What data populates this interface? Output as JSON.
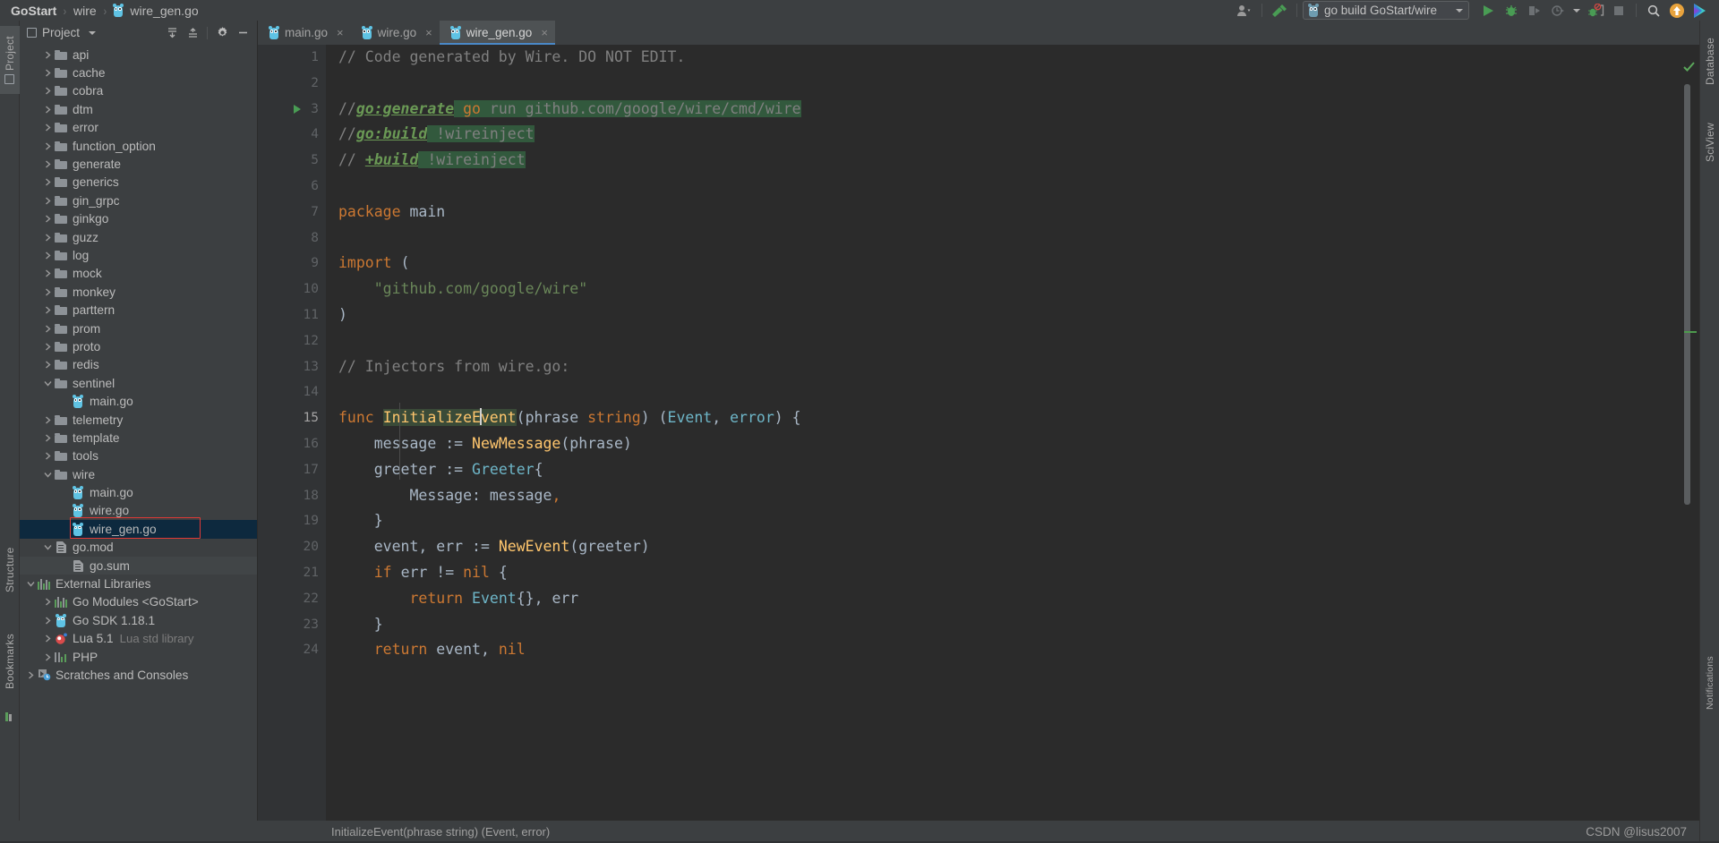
{
  "breadcrumb": {
    "project": "GoStart",
    "folder": "wire",
    "file": "wire_gen.go",
    "separator": "›"
  },
  "toolbar": {
    "user_icon": "user-avatar-icon",
    "build_icon": "hammer-icon",
    "run_config": "go build GoStart/wire",
    "run_icon": "run-play-icon",
    "debug_icon": "debug-bug-icon",
    "run_coverage_icon": "run-with-coverage-icon",
    "profiler_icon": "profiler-icon",
    "attach_icon": "attach-debugger-icon",
    "stop_icon": "stop-icon",
    "search_icon": "search-everywhere-icon",
    "update_icon": "update-project-icon",
    "ide_icon": "ide-logo-icon"
  },
  "left_strip": {
    "items": [
      {
        "label": "Project",
        "selected": true
      },
      {
        "label": "Structure",
        "selected": false
      },
      {
        "label": "Bookmarks",
        "selected": false
      }
    ]
  },
  "right_strip": {
    "items": [
      {
        "label": "Database"
      },
      {
        "label": "SciView"
      },
      {
        "label": "Notifications"
      }
    ]
  },
  "project_panel": {
    "title": "Project",
    "tools": {
      "expand_all": "expand-all-icon",
      "collapse_all": "collapse-all-icon",
      "settings": "gear-icon",
      "hide": "hide-panel-icon",
      "dropdown": "chevron-down-icon"
    },
    "tree": [
      {
        "label": "api",
        "type": "folder",
        "indent": 1,
        "state": "collapsed"
      },
      {
        "label": "cache",
        "type": "folder",
        "indent": 1,
        "state": "collapsed"
      },
      {
        "label": "cobra",
        "type": "folder",
        "indent": 1,
        "state": "collapsed"
      },
      {
        "label": "dtm",
        "type": "folder",
        "indent": 1,
        "state": "collapsed"
      },
      {
        "label": "error",
        "type": "folder",
        "indent": 1,
        "state": "collapsed"
      },
      {
        "label": "function_option",
        "type": "folder",
        "indent": 1,
        "state": "collapsed"
      },
      {
        "label": "generate",
        "type": "folder",
        "indent": 1,
        "state": "collapsed"
      },
      {
        "label": "generics",
        "type": "folder",
        "indent": 1,
        "state": "collapsed"
      },
      {
        "label": "gin_grpc",
        "type": "folder",
        "indent": 1,
        "state": "collapsed"
      },
      {
        "label": "ginkgo",
        "type": "folder",
        "indent": 1,
        "state": "collapsed"
      },
      {
        "label": "guzz",
        "type": "folder",
        "indent": 1,
        "state": "collapsed"
      },
      {
        "label": "log",
        "type": "folder",
        "indent": 1,
        "state": "collapsed"
      },
      {
        "label": "mock",
        "type": "folder",
        "indent": 1,
        "state": "collapsed"
      },
      {
        "label": "monkey",
        "type": "folder",
        "indent": 1,
        "state": "collapsed"
      },
      {
        "label": "parttern",
        "type": "folder",
        "indent": 1,
        "state": "collapsed"
      },
      {
        "label": "prom",
        "type": "folder",
        "indent": 1,
        "state": "collapsed"
      },
      {
        "label": "proto",
        "type": "folder",
        "indent": 1,
        "state": "collapsed"
      },
      {
        "label": "redis",
        "type": "folder",
        "indent": 1,
        "state": "collapsed"
      },
      {
        "label": "sentinel",
        "type": "folder",
        "indent": 1,
        "state": "expanded"
      },
      {
        "label": "main.go",
        "type": "go",
        "indent": 2,
        "state": "leaf"
      },
      {
        "label": "telemetry",
        "type": "folder",
        "indent": 1,
        "state": "collapsed"
      },
      {
        "label": "template",
        "type": "folder",
        "indent": 1,
        "state": "collapsed"
      },
      {
        "label": "tools",
        "type": "folder",
        "indent": 1,
        "state": "collapsed"
      },
      {
        "label": "wire",
        "type": "folder",
        "indent": 1,
        "state": "expanded"
      },
      {
        "label": "main.go",
        "type": "go",
        "indent": 2,
        "state": "leaf"
      },
      {
        "label": "wire.go",
        "type": "go",
        "indent": 2,
        "state": "leaf"
      },
      {
        "label": "wire_gen.go",
        "type": "go",
        "indent": 2,
        "state": "leaf",
        "selected": true,
        "highlighted": true
      },
      {
        "label": "go.mod",
        "type": "doc",
        "indent": 1,
        "state": "expanded"
      },
      {
        "label": "go.sum",
        "type": "doc",
        "indent": 2,
        "state": "leaf",
        "shaded": true
      },
      {
        "label": "External Libraries",
        "type": "bars",
        "indent": 0,
        "state": "expanded"
      },
      {
        "label": "Go Modules <GoStart>",
        "type": "bars",
        "indent": 1,
        "state": "collapsed"
      },
      {
        "label": "Go SDK 1.18.1",
        "type": "go",
        "indent": 1,
        "state": "collapsed"
      },
      {
        "label": "Lua 5.1",
        "sub": "Lua std library",
        "type": "lua",
        "indent": 1,
        "state": "collapsed"
      },
      {
        "label": "PHP",
        "type": "php",
        "indent": 1,
        "state": "collapsed"
      },
      {
        "label": "Scratches and Consoles",
        "type": "scratch",
        "indent": 0,
        "state": "collapsed"
      }
    ]
  },
  "editor": {
    "tabs": [
      {
        "label": "main.go",
        "active": false,
        "close": "×"
      },
      {
        "label": "wire.go",
        "active": false,
        "close": "×"
      },
      {
        "label": "wire_gen.go",
        "active": true,
        "close": "×"
      }
    ],
    "lines": [
      {
        "n": "1",
        "html": "<span class='c-cmt'>// Code generated by Wire. DO NOT EDIT.</span>"
      },
      {
        "n": "2",
        "html": ""
      },
      {
        "n": "3",
        "html": "<span class='c-cmt'>//</span><span class='c-dir'>go:generate</span><span class='hl-green'> <span class='c-kw'>go</span> <span class='c-cmt'>run github.com/google/wire/cmd/wire</span></span>",
        "run_marker": true,
        "fold": "open"
      },
      {
        "n": "4",
        "html": "<span class='c-cmt'>//</span><span class='c-dir'>go:build</span><span class='hl-green'> <span class='c-cmt'>!wireinject</span></span>"
      },
      {
        "n": "5",
        "html": "<span class='c-cmt'>// </span><span class='c-dir'>+build</span><span class='hl-green'> <span class='c-cmt'>!wireinject</span></span>",
        "fold": "end"
      },
      {
        "n": "6",
        "html": ""
      },
      {
        "n": "7",
        "html": "<span class='c-kw'>package</span> <span class='c-txt'>main</span>"
      },
      {
        "n": "8",
        "html": ""
      },
      {
        "n": "9",
        "html": "<span class='c-kw'>import</span> <span class='c-txt'>(</span>",
        "fold": "open"
      },
      {
        "n": "10",
        "html": "    <span class='c-str'>\"github.com/google/wire\"</span>"
      },
      {
        "n": "11",
        "html": "<span class='c-txt'>)</span>",
        "fold": "end"
      },
      {
        "n": "12",
        "html": ""
      },
      {
        "n": "13",
        "html": "<span class='c-cmt'>// Injectors from wire.go:</span>"
      },
      {
        "n": "14",
        "html": ""
      },
      {
        "n": "15",
        "html": "<span class='c-kw'>func</span> <span class='hl-ident c-fun'>InitializeE<span class='cursor'></span>vent</span><span class='c-txt'>(</span><span class='c-txt'>phrase </span><span class='c-kw'>string</span><span class='c-txt'>) (</span><span class='c-typ'>Event</span><span class='c-txt'>, </span><span class='c-typ'>error</span><span class='c-txt'>) {</span>",
        "fold": "open",
        "current": true
      },
      {
        "n": "16",
        "html": "    <span class='c-txt'>message := </span><span class='c-fun'>NewMessage</span><span class='c-txt'>(phrase)</span>"
      },
      {
        "n": "17",
        "html": "    <span class='c-txt'>greeter := </span><span class='c-typ'>Greeter</span><span class='c-txt'>{</span>",
        "fold": "open"
      },
      {
        "n": "18",
        "html": "        <span class='c-txt'>Message: message</span><span class='c-kw'>,</span>"
      },
      {
        "n": "19",
        "html": "    <span class='c-txt'>}</span>",
        "fold": "end"
      },
      {
        "n": "20",
        "html": "    <span class='c-txt'>event, err := </span><span class='c-fun'>NewEvent</span><span class='c-txt'>(greeter)</span>"
      },
      {
        "n": "21",
        "html": "    <span class='c-kw'>if</span> <span class='c-txt'>err != </span><span class='c-kw'>nil</span> <span class='c-txt'>{</span>",
        "fold": "open"
      },
      {
        "n": "22",
        "html": "        <span class='c-kw'>return</span> <span class='c-typ'>Event</span><span class='c-txt'>{}, err</span>"
      },
      {
        "n": "23",
        "html": "    <span class='c-txt'>}</span>",
        "fold": "end"
      },
      {
        "n": "24",
        "html": "    <span class='c-kw'>return</span> <span class='c-txt'>event, </span><span class='c-kw'>nil</span>"
      }
    ]
  },
  "status_bar": {
    "signature": "InitializeEvent(phrase string) (Event, error)",
    "watermark": "CSDN @lisus2007"
  },
  "colors": {
    "panel_bg": "#3c3f41",
    "editor_bg": "#2b2b2b",
    "gutter_bg": "#313335",
    "selection": "#0d293e",
    "tab_active": "#4e5254",
    "tab_underline": "#4a88c7",
    "annotation_red": "#e03a36",
    "keyword": "#cc7832",
    "string": "#6a8759",
    "function": "#ffc66d",
    "type": "#6eb6c8",
    "comment": "#808080",
    "directive_green": "#6a9955",
    "highlight_green": "#32593d"
  }
}
